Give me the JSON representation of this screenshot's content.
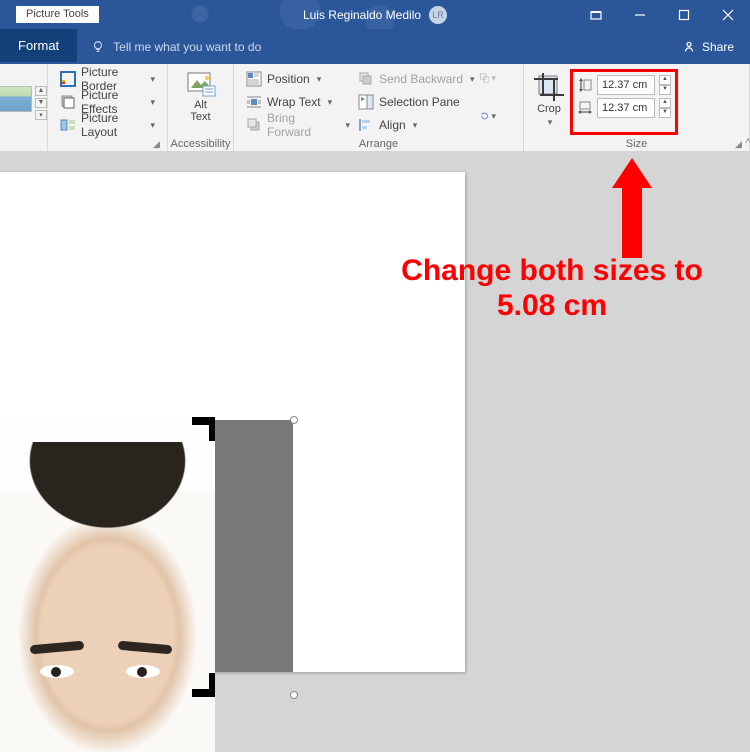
{
  "titlebar": {
    "contextual_tab": "Picture Tools",
    "username": "Luis Reginaldo Medilo",
    "avatar_initials": "LR"
  },
  "tabs": {
    "format": "Format",
    "tellme_placeholder": "Tell me what you want to do",
    "share": "Share"
  },
  "ribbon": {
    "picture_border": "Picture Border",
    "picture_effects": "Picture Effects",
    "picture_layout": "Picture Layout",
    "alt_text": "Alt Text",
    "accessibility_label": "Accessibility",
    "position": "Position",
    "wrap_text": "Wrap Text",
    "bring_forward": "Bring Forward",
    "send_backward": "Send Backward",
    "selection_pane": "Selection Pane",
    "align": "Align",
    "arrange_label": "Arrange",
    "crop": "Crop",
    "size_label": "Size",
    "height_value": "12.37 cm",
    "width_value": "12.37 cm"
  },
  "annotation": {
    "text": "Change both sizes to 5.08 cm"
  }
}
